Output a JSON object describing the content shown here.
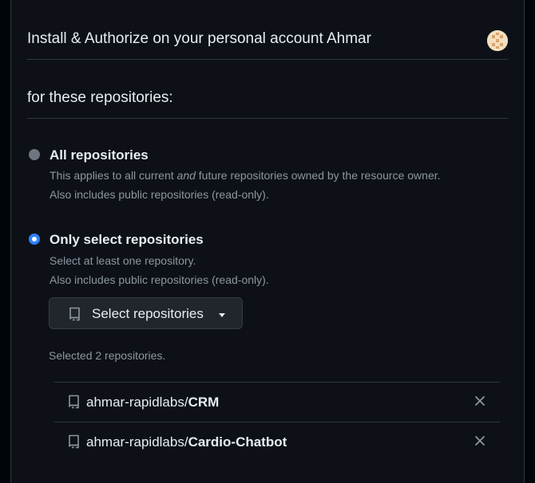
{
  "header": {
    "title": "Install & Authorize on your personal account Ahmar",
    "avatar_icon": "identicon-avatar"
  },
  "repos_section": {
    "title": "for these repositories:"
  },
  "options": [
    {
      "label": "All repositories",
      "desc_line1_pre": "This applies to all current ",
      "desc_line1_em": "and",
      "desc_line1_post": " future repositories owned by the resource owner.",
      "desc_line2": "Also includes public repositories (read-only).",
      "selected": false
    },
    {
      "label": "Only select repositories",
      "desc_line1": "Select at least one repository.",
      "desc_line2": "Also includes public repositories (read-only).",
      "selected": true
    }
  ],
  "select_button": {
    "label": "Select repositories",
    "icon": "repo-icon"
  },
  "selected_count": "Selected 2 repositories.",
  "repositories": [
    {
      "owner": "ahmar-rapidlabs/",
      "name": "CRM"
    },
    {
      "owner": "ahmar-rapidlabs/",
      "name": "Cardio-Chatbot"
    }
  ],
  "colors": {
    "accent": "#2f81f7",
    "background": "#0d1117",
    "border": "#30363d",
    "muted_text": "#8d96a0"
  }
}
